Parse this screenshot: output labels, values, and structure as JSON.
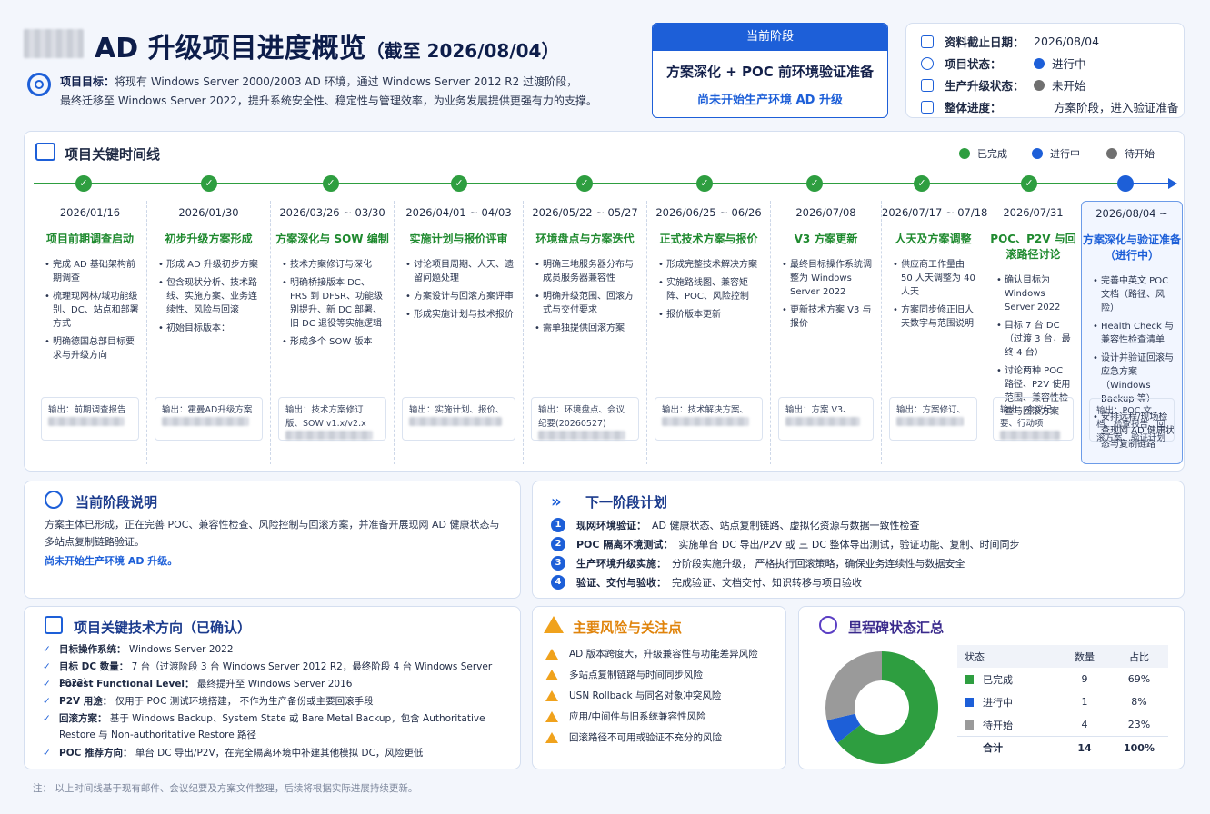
{
  "header": {
    "title": "AD 升级项目进度概览",
    "title_date": "（截至 2026/08/04）",
    "goal_label": "项目目标：",
    "goal_line1": "将现有 Windows Server 2000/2003 AD 环境，通过 Windows Server 2012 R2 过渡阶段，",
    "goal_line2": "最终迁移至 Windows Server 2022，提升系统安全性、稳定性与管理效率，为业务发展提供更强有力的支撑。"
  },
  "phase": {
    "head": "当前阶段",
    "main": "方案深化 + POC 前环境验证准备",
    "sub": "尚未开始生产环境 AD 升级"
  },
  "info": {
    "rows": [
      {
        "label": "资料截止日期：",
        "value": "2026/08/04"
      },
      {
        "label": "项目状态：",
        "value": "进行中"
      },
      {
        "label": "生产升级状态：",
        "value": "未开始"
      },
      {
        "label": "整体进度：",
        "value": "方案阶段，进入验证准备"
      }
    ]
  },
  "timeline": {
    "title": "项目关键时间线",
    "legend": [
      "已完成",
      "进行中",
      "待开始"
    ],
    "items": [
      {
        "date": "2026/01/16",
        "title": "项目前期调查启动",
        "bullets": [
          "完成 AD 基础架构前期调查",
          "梳理现网林/域功能级别、DC、站点和部署方式",
          "明确德国总部目标要求与升级方向"
        ],
        "out": "输出：前期调查报告"
      },
      {
        "date": "2026/01/30",
        "title": "初步升级方案形成",
        "bullets": [
          "形成 AD 升级初步方案",
          "包含现状分析、技术路线、实施方案、业务连续性、风险与回滚",
          "初始目标版本："
        ],
        "out": "输出：霍曼AD升级方案"
      },
      {
        "date": "2026/03/26 ~ 03/30",
        "title": "方案深化与 SOW 编制",
        "bullets": [
          "技术方案修订与深化",
          "明确桥接版本 DC、FRS 到 DFSR、功能级别提升、新 DC 部署、旧 DC 退役等实施逻辑",
          "形成多个 SOW 版本"
        ],
        "out": "输出：技术方案修订版、SOW v1.x/v2.x"
      },
      {
        "date": "2026/04/01 ~ 04/03",
        "title": "实施计划与报价评审",
        "bullets": [
          "讨论项目周期、人天、遗留问题处理",
          "方案设计与回滚方案评审",
          "形成实施计划与技术报价"
        ],
        "out": "输出：实施计划、报价、"
      },
      {
        "date": "2026/05/22 ~ 05/27",
        "title": "环境盘点与方案迭代",
        "bullets": [
          "明确三地服务器分布与成员服务器兼容性",
          "明确升级范围、回滚方式与交付要求",
          "需单独提供回滚方案"
        ],
        "out": "输出：环境盘点、会议纪要(20260527)"
      },
      {
        "date": "2026/06/25 ~ 06/26",
        "title": "正式技术方案与报价",
        "bullets": [
          "形成完整技术解决方案",
          "实施路线图、兼容矩阵、POC、风险控制",
          "报价版本更新"
        ],
        "out": "输出：技术解决方案、"
      },
      {
        "date": "2026/07/08",
        "title": "V3 方案更新",
        "bullets": [
          "最终目标操作系统调整为 Windows Server 2022",
          "更新技术方案 V3 与报价"
        ],
        "out": "输出：方案 V3、"
      },
      {
        "date": "2026/07/17 ~ 07/18",
        "title": "人天及方案调整",
        "bullets": [
          "供应商工作量由 50 人天调整为 40 人天",
          "方案同步修正旧人天数字与范围说明"
        ],
        "out": "输出：方案修订、"
      },
      {
        "date": "2026/07/31",
        "title": "POC、P2V 与回滚路径讨论",
        "bullets": [
          "确认目标为 Windows Server 2022",
          "目标 7 台 DC（过渡 3 台，最终 4 台）",
          "讨论两种 POC 路径、P2V 使用范围、兼容性检查与回滚方案"
        ],
        "out": "输出：会议纪要、行动项"
      },
      {
        "date": "2026/08/04 ~",
        "title": "方案深化与验证准备（进行中）",
        "bullets": [
          "完善中英文 POC 文档（路径、风险）",
          "Health Check 与兼容性检查清单",
          "设计并验证回滚与应急方案（Windows Backup 等）",
          "安排远程/现场检查现网 AD 健康状态与复制链路"
        ],
        "out": "输出：POC 文档、检查报告、回滚方案、验证计划"
      }
    ]
  },
  "current": {
    "title": "当前阶段说明",
    "text": "方案主体已形成，正在完善 POC、兼容性检查、风险控制与回滚方案，并准备开展现网 AD 健康状态与多站点复制链路验证。",
    "highlight": "尚未开始生产环境 AD 升级。"
  },
  "next": {
    "title": "下一阶段计划",
    "items": [
      {
        "n": "1",
        "label": "现网环境验证：",
        "text": "AD 健康状态、站点复制链路、虚拟化资源与数据一致性检查"
      },
      {
        "n": "2",
        "label": "POC 隔离环境测试：",
        "text": "实施单台 DC 导出/P2V 或 三 DC 整体导出测试，验证功能、复制、时间同步"
      },
      {
        "n": "3",
        "label": "生产环境升级实施：",
        "text": "分阶段实施升级， 严格执行回滚策略，确保业务连续性与数据安全"
      },
      {
        "n": "4",
        "label": "验证、交付与验收：",
        "text": "完成验证、文档交付、知识转移与项目验收"
      }
    ]
  },
  "tech": {
    "title": "项目关键技术方向（已确认）",
    "items": [
      {
        "label": "目标操作系统：",
        "text": "Windows Server 2022"
      },
      {
        "label": "目标 DC 数量：",
        "text": "7 台（过渡阶段 3 台 Windows Server 2012 R2，最终阶段 4 台 Windows Server 2022）"
      },
      {
        "label": "Forest Functional Level：",
        "text": "最终提升至 Windows Server 2016"
      },
      {
        "label": "P2V 用途：",
        "text": "仅用于 POC 测试环境搭建， 不作为生产备份或主要回滚手段"
      },
      {
        "label": "回滚方案：",
        "text": "基于 Windows Backup、System State 或 Bare Metal Backup，包含 Authoritative Restore 与 Non-authoritative Restore 路径"
      },
      {
        "label": "POC 推荐方向：",
        "text": "单台 DC 导出/P2V，在完全隔离环境中补建其他模拟 DC，风险更低"
      }
    ]
  },
  "risks": {
    "title": "主要风险与关注点",
    "items": [
      "AD 版本跨度大，升级兼容性与功能差异风险",
      "多站点复制链路与时间同步风险",
      "USN Rollback 与同名对象冲突风险",
      "应用/中间件与旧系统兼容性风险",
      "回滚路径不可用或验证不充分的风险"
    ]
  },
  "milestones": {
    "title": "里程碑状态汇总",
    "headers": [
      "状态",
      "数量",
      "占比"
    ],
    "rows": [
      {
        "status": "已完成",
        "count": "9",
        "pct": "69%"
      },
      {
        "status": "进行中",
        "count": "1",
        "pct": "8%"
      },
      {
        "status": "待开始",
        "count": "4",
        "pct": "23%"
      }
    ],
    "total": {
      "label": "合计",
      "count": "14",
      "pct": "100%"
    }
  },
  "chart_data": {
    "type": "pie",
    "categories": [
      "已完成",
      "进行中",
      "待开始"
    ],
    "values": [
      9,
      1,
      4
    ]
  },
  "colors": {
    "done": "#2e9e40",
    "active": "#1d5fd8",
    "pending": "#9a9a9a"
  },
  "footer": "注：  以上时间线基于现有邮件、会议纪要及方案文件整理，后续将根据实际进展持续更新。"
}
